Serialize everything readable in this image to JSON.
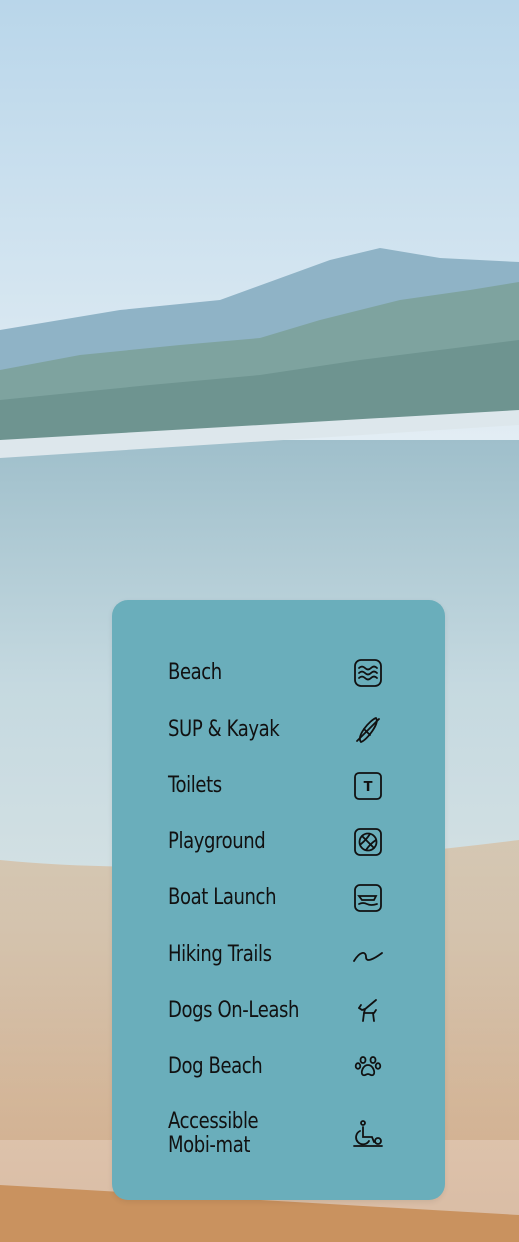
{
  "amenities": [
    {
      "label": "Beach",
      "icon": "waves-icon"
    },
    {
      "label": "SUP & Kayak",
      "icon": "kayak-icon"
    },
    {
      "label": "Toilets",
      "icon": "toilet-icon",
      "icon_text": "T"
    },
    {
      "label": "Playground",
      "icon": "playground-icon"
    },
    {
      "label": "Boat Launch",
      "icon": "boat-launch-icon"
    },
    {
      "label": "Hiking Trails",
      "icon": "trail-icon"
    },
    {
      "label": "Dogs On-Leash",
      "icon": "dog-leash-icon"
    },
    {
      "label": "Dog Beach",
      "icon": "paw-icon"
    },
    {
      "label": "Accessible\nMobi-mat",
      "icon": "wheelchair-icon"
    }
  ],
  "colors": {
    "card": "#6AAEBB",
    "text": "#111111",
    "sky": "#CFE3F0",
    "water": "#A9C8D4",
    "sand": "#C79A6F"
  }
}
